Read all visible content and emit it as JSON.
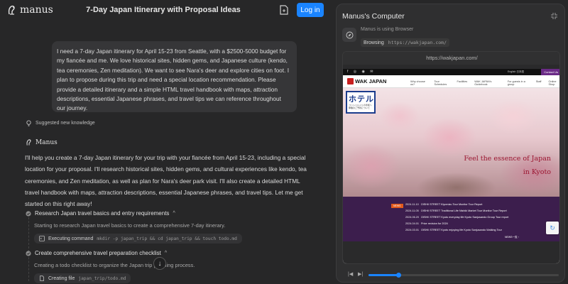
{
  "app": {
    "logo_text": "manus",
    "title": "7-Day Japan Itinerary with Proposal Ideas",
    "login_label": "Log in"
  },
  "user_message": "I need a 7-day Japan itinerary for April 15-23 from Seattle, with a $2500-5000 budget for my fiancée and me. We love historical sites, hidden gems, and Japanese culture (kendo, tea ceremonies, Zen meditation). We want to see Nara's deer and explore cities on foot. I plan to propose during this trip and need a special location recommendation. Please provide a detailed itinerary and a simple HTML travel handbook with maps, attraction descriptions, essential Japanese phrases, and travel tips we can reference throughout our journey.",
  "knowledge_label": "Suggested new knowledge",
  "agent": {
    "name": "Manus",
    "message": "I'll help you create a 7-day Japan itinerary for your trip with your fiancée from April 15-23, including a special location for your proposal. I'll research historical sites, hidden gems, and cultural experiences like kendo, tea ceremonies, and Zen meditation, as well as plan for Nara's deer park visit. I'll also create a detailed HTML travel handbook with maps, attraction descriptions, essential Japanese phrases, and travel tips. Let me get started on this right away!"
  },
  "steps": [
    {
      "title": "Research Japan travel basics and entry requirements",
      "description": "Starting to research Japan travel basics to create a comprehensive 7-day itinerary.",
      "action_label": "Executing command",
      "action_detail": "mkdir -p japan_trip && cd japan_trip && touch todo.md"
    },
    {
      "title": "Create comprehensive travel preparation checklist",
      "description": "Creating a todo checklist to organize the Japan trip planning process.",
      "action_label": "Creating file",
      "action_detail": "japan_trip/todo.md"
    }
  ],
  "computer": {
    "title": "Manus's Computer",
    "using_text": "Manus is using Browser",
    "browsing_label": "Browsing",
    "browsing_url": "https://wakjapan.com/",
    "address_bar": "https://wakjapan.com/",
    "playback_progress": 0.16
  },
  "website": {
    "brand": "WAK JAPAN",
    "contact": "Contact Us",
    "lang": "English 日本語",
    "nav": [
      "Why choose us?",
      "Tour Schedules",
      "Facilities",
      "WAK JAPAN's Guidebook",
      "For guests in a group",
      "Staff",
      "Online Shop"
    ],
    "hotel_sign_big": "ホテル",
    "hotel_sign_small": "コンシェルジュの皆様へ 体験のご予約について",
    "hero_line1": "Feel the essence of Japan",
    "hero_line2": "in Kyoto",
    "news_tag": "NEWS",
    "news": [
      {
        "date": "2024.11.10",
        "text": "OISHII STREET Kiyomizu Tour Monitor Tour Report"
      },
      {
        "date": "2024.11.05",
        "text": "OISHII STREET Traditional Life Nishiki Market Tour Monitor Tour Report"
      },
      {
        "date": "2024.06.20",
        "text": "OISHII STREET Kyoto everyday life Kyoto Sanjusando Group Tour report"
      },
      {
        "date": "2024.04.01",
        "text": "Price revision for 2024"
      },
      {
        "date": "2024.03.01",
        "text": "OISHII STREET Kyoto enjoying life Kyoto Sanjusando Walking Tour"
      }
    ],
    "news_more": "NEWS一覧 ›"
  },
  "colors": {
    "accent": "#1a84ff",
    "site_purple": "#3c1e4d",
    "hero_text": "#9b1530"
  }
}
